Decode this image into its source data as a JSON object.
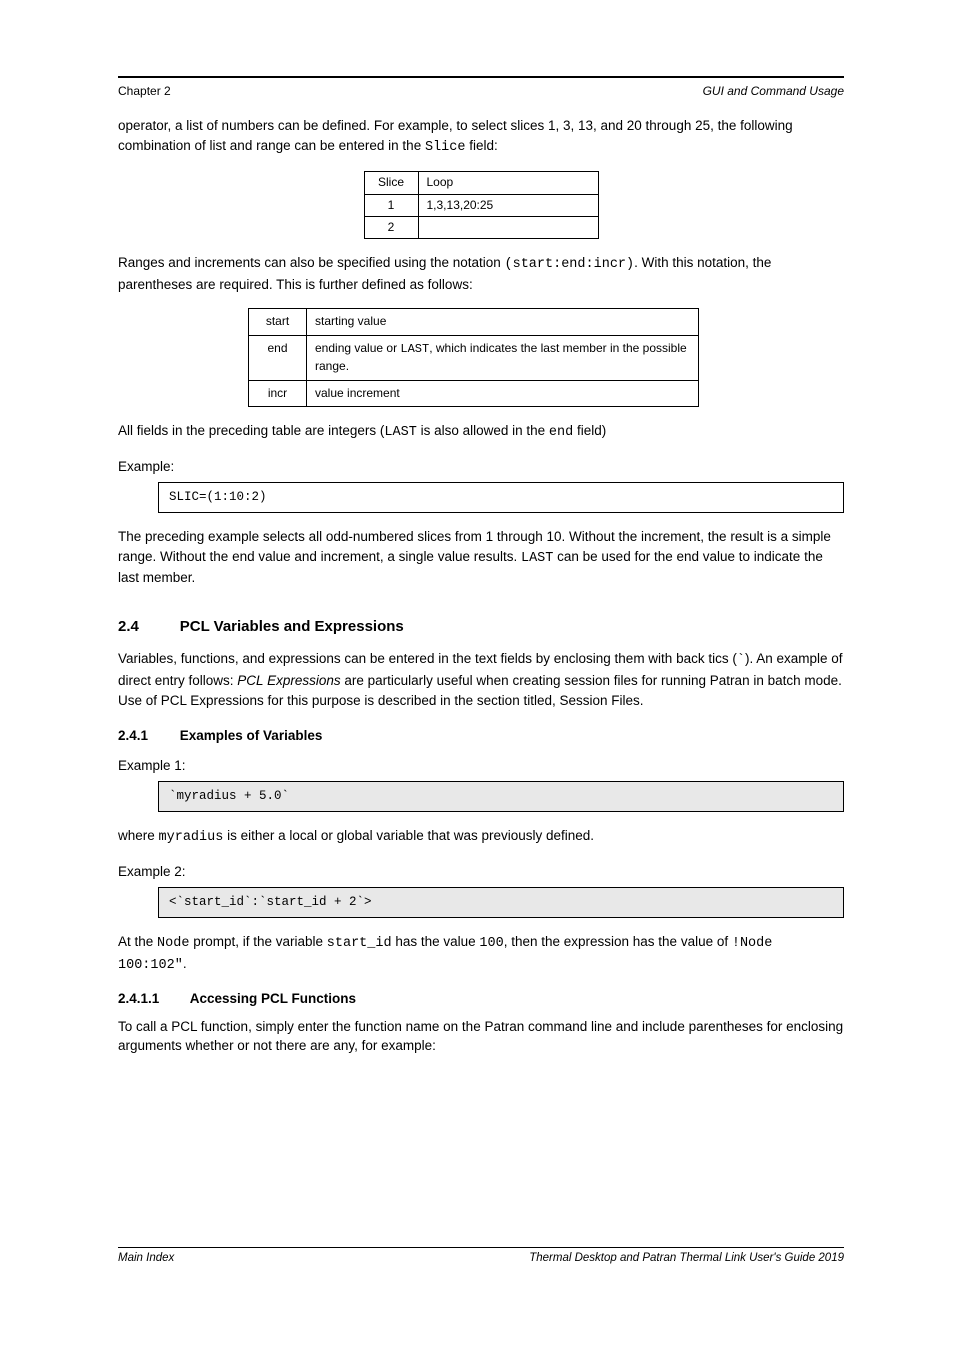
{
  "header": {
    "left": "Chapter 2",
    "right": "GUI and Command Usage"
  },
  "intro1_pre": "operator, a list of numbers can be defined. For example, to select slices 1, 3, 13, and 20 through 25, the following combination of list and range can be entered in the ",
  "intro1_code": "Slice",
  "intro1_post": " field:",
  "table1": {
    "h1": "Slice",
    "h2": "Loop",
    "r1c1": "1",
    "r1c2": "1,3,13,20:25",
    "r2c1": "2",
    "r2c2": ""
  },
  "range_para_pre": "Ranges and increments can also be specified using the notation ",
  "range_code": "(start:end:incr)",
  "range_para_post": ". With this notation, the parentheses are required. This is further defined as follows:",
  "table2": {
    "h1": "start",
    "h1d": "starting value",
    "r2c1": "end",
    "r2c2_a": "ending value or ",
    "r2c2_code": "LAST",
    "r2c2_b": ", which indicates the last member in the possible range.",
    "r3c1": "incr",
    "r3c2": "value increment"
  },
  "table2_note_pre": "All fields in the preceding table are integers (",
  "table2_note_code1": "LAST",
  "table2_note_mid": " is also allowed in the ",
  "table2_note_code2": "end",
  "table2_note_post": " field)",
  "example1_label": "Example:",
  "example1_code": "SLIC=(1:10:2)",
  "example1_desc_pre": "The preceding example selects all odd-numbered slices from 1 through 10. Without the increment, the result is a simple range. Without the end value and increment, a single value results. ",
  "example1_code2": "LAST",
  "example1_desc_post": " can be used for the end value to indicate the last member.",
  "section": {
    "num": "2.4",
    "title": "PCL Variables and Expressions",
    "desc_pre": "Variables, functions, and expressions can be entered in the text fields by enclosing them with back tics (",
    "desc_tic": "`",
    "desc_post": "). An example of direct entry follows: ",
    "desc_pcl_link": "PCL Expressions",
    "desc_tail": " are particularly useful when creating session files for running Patran in batch mode. Use of PCL Expressions for this purpose is described in the section titled, Session Files."
  },
  "sub": {
    "num": "2.4.1",
    "title": "Examples of Variables",
    "example_label": "Example 1:",
    "example1_code": "`myradius + 5.0`",
    "example1_desc_pre": "where ",
    "example1_desc_code": "myradius",
    "example1_desc_post": " is either a local or global variable that was previously defined.",
    "example2_label": "Example 2:",
    "example2_code": "<`start_id`:`start_id + 2`>",
    "example2_desc_pre": "At the ",
    "example2_code_node": "Node",
    "example2_desc_mid": " prompt, if the variable ",
    "example2_code_start": "start_id",
    "example2_desc_mid2": " has the value ",
    "example2_code_val": "100",
    "example2_desc_mid3": ", then the expression has the value of ",
    "example2_code_res": "!Node 100:102\"",
    "example2_desc_post": "."
  },
  "subsub": {
    "num": "2.4.1.1",
    "title": "Accessing PCL Functions",
    "desc": "To call a PCL function, simply enter the function name on the Patran command line and include parentheses for enclosing arguments whether or not there are any, for example:"
  },
  "footer": {
    "left": "Main Index",
    "right": "Thermal Desktop and Patran Thermal Link User's Guide 2019"
  }
}
